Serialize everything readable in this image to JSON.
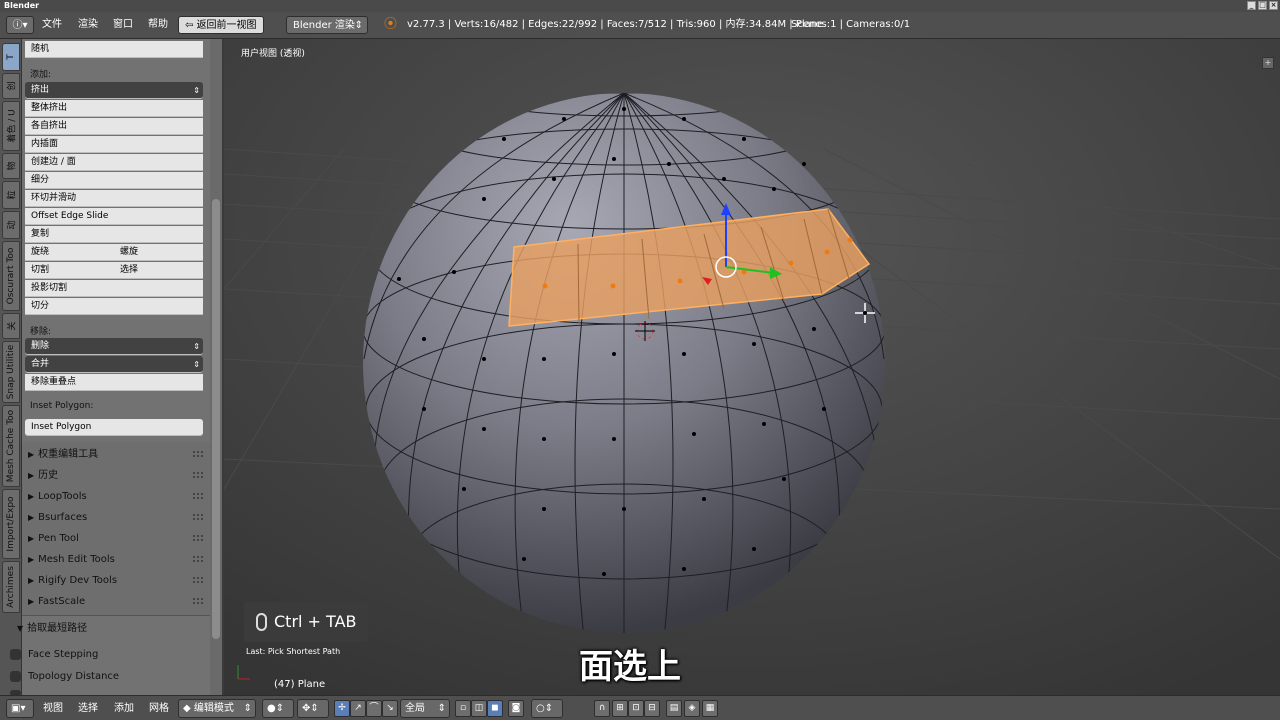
{
  "window": {
    "title": "Blender"
  },
  "menu": {
    "file": "文件",
    "render": "渲染",
    "window": "窗口",
    "help": "帮助",
    "back": "返回前一视图",
    "engine": "Blender 渲染"
  },
  "info": {
    "stats": "v2.77.3 | Verts:16/482 | Edges:22/992 | Faces:7/512 | Tris:960 | 内存:34.84M | Plane",
    "scenes": "Scenes:1 | Cameras:0/1"
  },
  "tabs": [
    "T",
    "创",
    "着色 / U",
    "物",
    "动",
    "Oscurart Too",
    "关",
    "Snap Utilitie",
    "Mesh Cache Too",
    "Import/Expo",
    "Archimes"
  ],
  "panel": {
    "random": "随机",
    "add_label": "添加:",
    "extrude": "挤出",
    "add_items": [
      "整体挤出",
      "各自挤出",
      "内插面",
      "创建边 / 面",
      "细分",
      "环切并滑动",
      "Offset Edge Slide",
      "复制"
    ],
    "spin": "旋绕",
    "screw": "螺旋",
    "knife": "切割",
    "select": "选择",
    "add_items2": [
      "投影切割",
      "切分"
    ],
    "remove_label": "移除:",
    "delete": "删除",
    "merge": "合并",
    "remove_doubles": "移除重叠点",
    "inset_label": "Inset Polygon:",
    "inset_button": "Inset Polygon",
    "sections": [
      "权重编辑工具",
      "历史",
      "LoopTools",
      "Bsurfaces",
      "Pen Tool",
      "Mesh Edit Tools",
      "Rigify Dev Tools",
      "FastScale"
    ],
    "shortest_path": "拾取最短路径",
    "face_stepping": "Face Stepping",
    "topology_distance": "Topology Distance"
  },
  "viewport": {
    "view_label": "用户视图 (透视)",
    "key_hint": "Ctrl + TAB",
    "last_op": "Last: Pick Shortest Path",
    "object": "(47) Plane",
    "subtitle": "面选上"
  },
  "bottom": {
    "view": "视图",
    "select": "选择",
    "add": "添加",
    "mesh": "网格",
    "mode": "编辑模式",
    "global": "全局"
  },
  "colors": {
    "selection": "#f0a050",
    "mesh_face": "#8a8a9a",
    "bg": "#3e3e3e"
  }
}
